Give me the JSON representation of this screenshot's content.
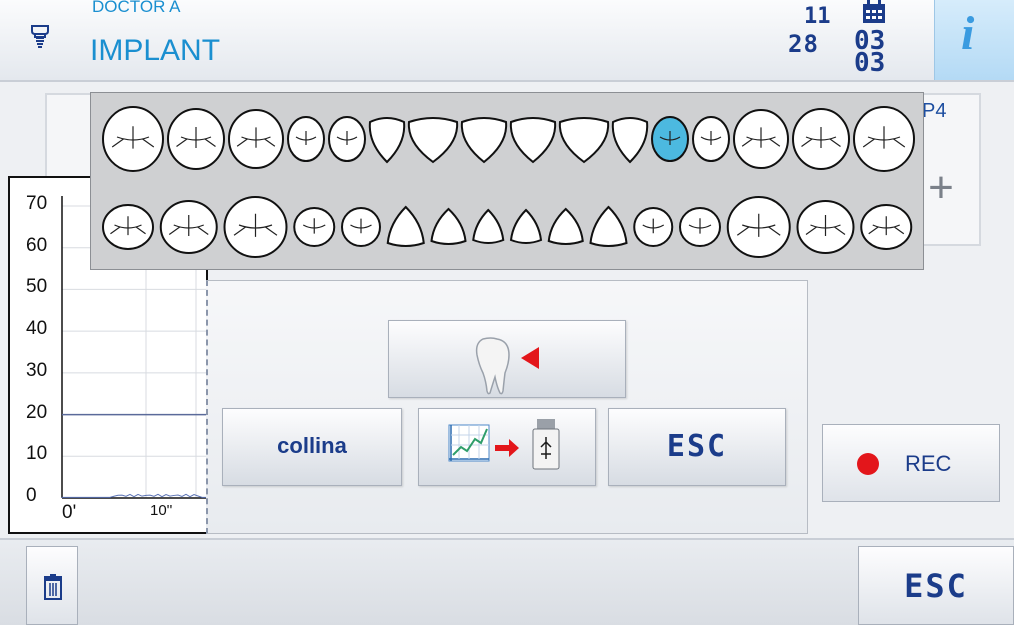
{
  "header": {
    "doctor": "DOCTOR A",
    "mode": "IMPLANT",
    "date_top": "11",
    "date_bottom": "28",
    "calendar_number": "03\n03",
    "info_glyph": "i"
  },
  "top_panel": {
    "tab_label": "P4",
    "plus_label": "+"
  },
  "chart_data": {
    "type": "line",
    "y_ticks": [
      "70",
      "60",
      "50",
      "40",
      "30",
      "20",
      "10",
      "0"
    ],
    "x_ticks": [
      "0'",
      "10''"
    ],
    "ylim": [
      0,
      70
    ],
    "threshold": 20,
    "grid": true
  },
  "teeth": {
    "selected_tooth": "upper-12",
    "selected_color": "#4cb9e0"
  },
  "menu": {
    "collina_label": "collina",
    "esc_label": "ESC",
    "icons": {
      "tooth_select": "tooth-select-icon",
      "export": "chart-to-usb-icon"
    }
  },
  "rec": {
    "label": "REC"
  },
  "footer": {
    "esc_label": "ESC",
    "trash_icon": "trash-icon"
  },
  "colors": {
    "accent": "#1a8fd0",
    "text_dark": "#1b3c8a",
    "rec_dot": "#e3161b",
    "info_bg": "#c6e4f9"
  }
}
